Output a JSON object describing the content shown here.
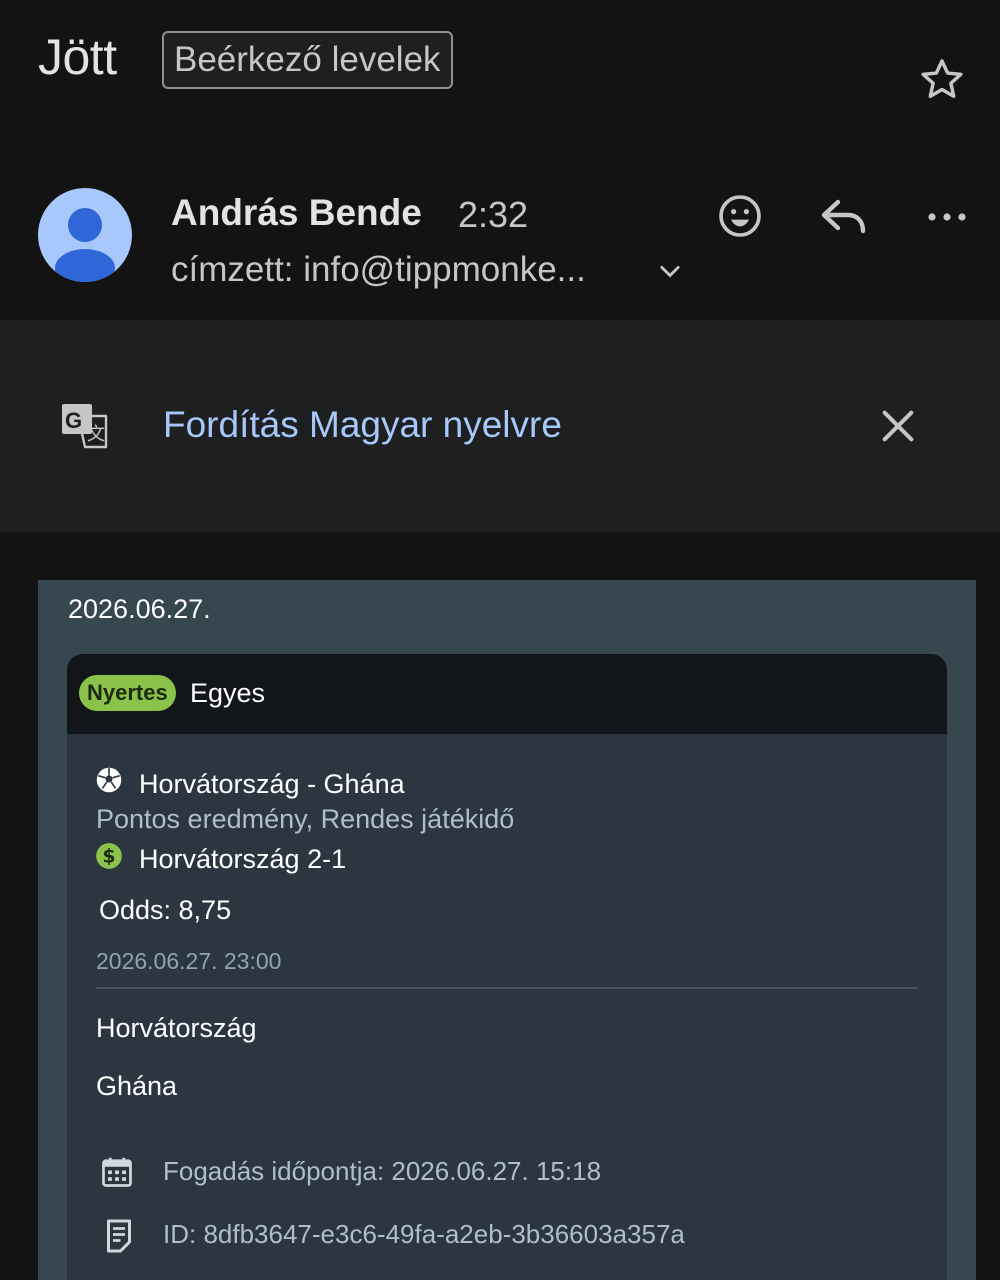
{
  "header": {
    "subject": "Jött",
    "label": "Beérkező levelek"
  },
  "sender": {
    "name": "András Bende",
    "time": "2:32",
    "recipient": "címzett: info@tippmonke..."
  },
  "translate": {
    "text": "Fordítás Magyar nyelvre"
  },
  "email": {
    "date": "2026.06.27.",
    "bet": {
      "status": "Nyertes",
      "type": "Egyes",
      "match": "Horvátország - Ghána",
      "market": "Pontos eredmény, Rendes játékidő",
      "selection": "Horvátország 2-1",
      "odds": "Odds: 8,75",
      "match_time": "2026.06.27. 23:00",
      "home_team": "Horvátország",
      "away_team": "Ghána",
      "bet_time": "Fogadás időpontja: 2026.06.27. 15:18",
      "bet_id": "ID: 8dfb3647-e3c6-49fa-a2eb-3b36603a357a"
    }
  },
  "colors": {
    "background": "#131314",
    "link_blue": "#a8c7fa",
    "email_body": "#37474f",
    "card": "#2b3641",
    "winner_green": "#8bc34a"
  },
  "icons": {
    "star": "star-icon",
    "emoji": "emoji-icon",
    "reply": "reply-icon",
    "more": "more-icon",
    "translate": "translate-icon",
    "close": "close-icon",
    "soccer": "soccer-ball-icon",
    "dollar": "dollar-icon",
    "calendar": "calendar-icon",
    "document": "document-icon"
  }
}
